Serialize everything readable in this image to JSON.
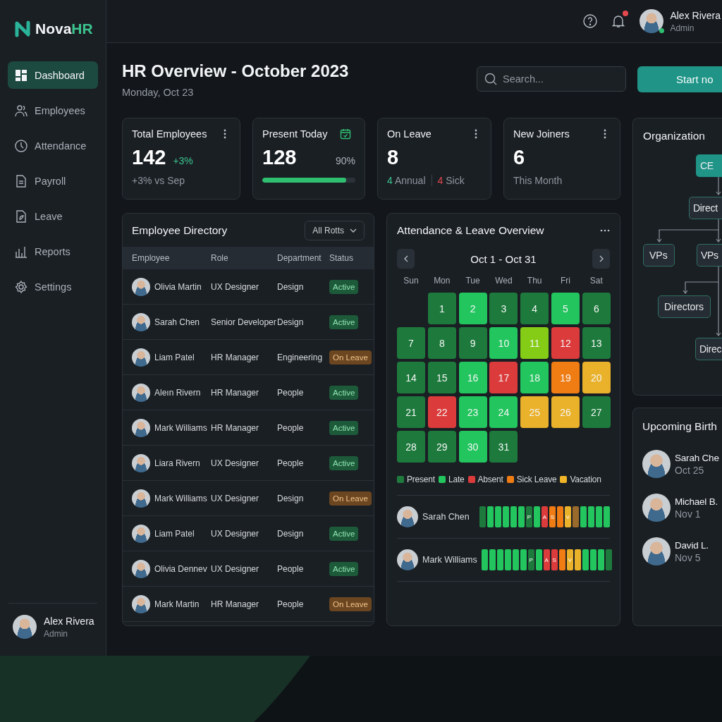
{
  "brand": {
    "name": "Nova",
    "accent": "HR"
  },
  "nav": [
    {
      "label": "Dashboard",
      "selected": true
    },
    {
      "label": "Employees",
      "selected": false
    },
    {
      "label": "Attendance",
      "selected": false
    },
    {
      "label": "Payroll",
      "selected": false
    },
    {
      "label": "Leave",
      "selected": false
    },
    {
      "label": "Reports",
      "selected": false
    },
    {
      "label": "Settings",
      "selected": false
    }
  ],
  "sidebar_user": {
    "name": "Alex Rivera",
    "role": "Admin"
  },
  "header_user": {
    "name": "Alex Rivera",
    "role": "Admin",
    "online": true
  },
  "notifications": {
    "unread": true
  },
  "page": {
    "title": "HR Overview - October 2023",
    "subtitle": "Monday, Oct 23"
  },
  "search": {
    "placeholder": "Search..."
  },
  "start_button": "Start no",
  "stats": [
    {
      "kind": "trend",
      "title": "Total Employees",
      "value": "142",
      "delta": "+3%",
      "note": "+3% vs Sep"
    },
    {
      "kind": "progress",
      "title": "Present Today",
      "value": "128",
      "percent": "90%",
      "level": 0.9
    },
    {
      "kind": "split",
      "title": "On Leave",
      "value": "8",
      "annual_count": "4",
      "annual": "Annual",
      "sick_count": "4",
      "sick": "Sick"
    },
    {
      "kind": "plain",
      "title": "New Joiners",
      "value": "6",
      "note": "This Month"
    }
  ],
  "directory": {
    "title": "Employee Directory",
    "filter": "All Rotts",
    "columns": [
      "Employee",
      "Role",
      "Department",
      "Status"
    ],
    "rows": [
      {
        "name": "Olivia Martin",
        "role": "UX Designer",
        "department": "Design",
        "status": "Active",
        "kind": "active"
      },
      {
        "name": "Sarah Chen",
        "role": "Senior Developer",
        "department": "Design",
        "status": "Active",
        "kind": "active"
      },
      {
        "name": "Liam Patel",
        "role": "HR Manager",
        "department": "Engineering",
        "status": "On Leave",
        "kind": "leave"
      },
      {
        "name": "Aleın Rivern",
        "role": "HR Manager",
        "department": "People",
        "status": "Active",
        "kind": "active"
      },
      {
        "name": "Mark Williams",
        "role": "HR Manager",
        "department": "People",
        "status": "Active",
        "kind": "active"
      },
      {
        "name": "Liara Rivern",
        "role": "UX Designer",
        "department": "People",
        "status": "Active",
        "kind": "active"
      },
      {
        "name": "Mark Williams",
        "role": "UX Designer",
        "department": "Design",
        "status": "On Leave",
        "kind": "leave"
      },
      {
        "name": "Liam Patel",
        "role": "UX Designer",
        "department": "Design",
        "status": "Active",
        "kind": "active"
      },
      {
        "name": "Olivia Dennev",
        "role": "UX Designer",
        "department": "People",
        "status": "Active",
        "kind": "active"
      },
      {
        "name": "Mark Martin",
        "role": "HR Manager",
        "department": "People",
        "status": "On Leave",
        "kind": "leave"
      }
    ]
  },
  "attendance": {
    "title": "Attendance & Leave Overview",
    "range": "Oct 1 - Oct 31",
    "weekdays": [
      "Sun",
      "Mon",
      "Tue",
      "Wed",
      "Thu",
      "Fri",
      "Sat"
    ],
    "days": [
      {
        "label": "1",
        "kind": "present"
      },
      {
        "label": "2",
        "kind": "late"
      },
      {
        "label": "3",
        "kind": "present"
      },
      {
        "label": "4",
        "kind": "present"
      },
      {
        "label": "5",
        "kind": "late"
      },
      {
        "label": "6",
        "kind": "present"
      },
      {
        "label": "7",
        "kind": "present"
      },
      {
        "label": "8",
        "kind": "present"
      },
      {
        "label": "9",
        "kind": "present"
      },
      {
        "label": "10",
        "kind": "late"
      },
      {
        "label": "11",
        "kind": "partial"
      },
      {
        "label": "12",
        "kind": "absent"
      },
      {
        "label": "13",
        "kind": "present"
      },
      {
        "label": "14",
        "kind": "present"
      },
      {
        "label": "15",
        "kind": "present"
      },
      {
        "label": "16",
        "kind": "late"
      },
      {
        "label": "17",
        "kind": "absent"
      },
      {
        "label": "18",
        "kind": "late"
      },
      {
        "label": "19",
        "kind": "sick"
      },
      {
        "label": "20",
        "kind": "vacation"
      },
      {
        "label": "21",
        "kind": "present"
      },
      {
        "label": "22",
        "kind": "absent"
      },
      {
        "label": "23",
        "kind": "late"
      },
      {
        "label": "24",
        "kind": "late"
      },
      {
        "label": "25",
        "kind": "vacation"
      },
      {
        "label": "26",
        "kind": "vacation"
      },
      {
        "label": "27",
        "kind": "present"
      },
      {
        "label": "28",
        "kind": "present"
      },
      {
        "label": "29",
        "kind": "present"
      },
      {
        "label": "30",
        "kind": "late"
      },
      {
        "label": "31",
        "kind": "present"
      }
    ],
    "legend": [
      {
        "label": "Present",
        "color": "#1f7a3e"
      },
      {
        "label": "Late",
        "color": "#22c55e"
      },
      {
        "label": "Absent",
        "color": "#dc3b3b"
      },
      {
        "label": "Sick Leave",
        "color": "#f07c14"
      },
      {
        "label": "Vacation",
        "color": "#f0b429"
      }
    ],
    "people": [
      {
        "name": "Sarah Chen",
        "segments": [
          {
            "kind": "present"
          },
          {
            "kind": "late"
          },
          {
            "kind": "late"
          },
          {
            "kind": "late"
          },
          {
            "kind": "late"
          },
          {
            "kind": "late"
          },
          {
            "kind": "present",
            "mark": "P"
          },
          {
            "kind": "late"
          },
          {
            "kind": "absent",
            "mark": "A"
          },
          {
            "kind": "sick",
            "mark": "S"
          },
          {
            "kind": "sick"
          },
          {
            "kind": "vacation",
            "mark": "V"
          },
          {
            "kind": "muted"
          },
          {
            "kind": "late"
          },
          {
            "kind": "late"
          },
          {
            "kind": "late"
          },
          {
            "kind": "late"
          }
        ]
      },
      {
        "name": "Mark Williams",
        "segments": [
          {
            "kind": "late"
          },
          {
            "kind": "late"
          },
          {
            "kind": "late"
          },
          {
            "kind": "late"
          },
          {
            "kind": "late"
          },
          {
            "kind": "late"
          },
          {
            "kind": "present",
            "mark": "P"
          },
          {
            "kind": "late"
          },
          {
            "kind": "absent",
            "mark": "A"
          },
          {
            "kind": "absent",
            "mark": "S"
          },
          {
            "kind": "sick"
          },
          {
            "kind": "vacation",
            "mark": "V"
          },
          {
            "kind": "vacation"
          },
          {
            "kind": "late"
          },
          {
            "kind": "late"
          },
          {
            "kind": "late"
          },
          {
            "kind": "present"
          }
        ]
      }
    ]
  },
  "organization": {
    "title": "Organization",
    "nodes": [
      {
        "label": "CE",
        "kind": "lead"
      },
      {
        "label": "Direct",
        "kind": "unit"
      },
      {
        "label": "VPs",
        "kind": "unit"
      },
      {
        "label": "VPs",
        "kind": "unit"
      },
      {
        "label": "Directors",
        "kind": "unit"
      },
      {
        "label": "Direc",
        "kind": "unit"
      }
    ]
  },
  "birthdays": {
    "title": "Upcoming Birth",
    "people": [
      {
        "name": "Sarah Che",
        "date": "Oct 25"
      },
      {
        "name": "Michael B.",
        "date": "Nov 1"
      },
      {
        "name": "David L.",
        "date": "Nov 5"
      }
    ]
  }
}
